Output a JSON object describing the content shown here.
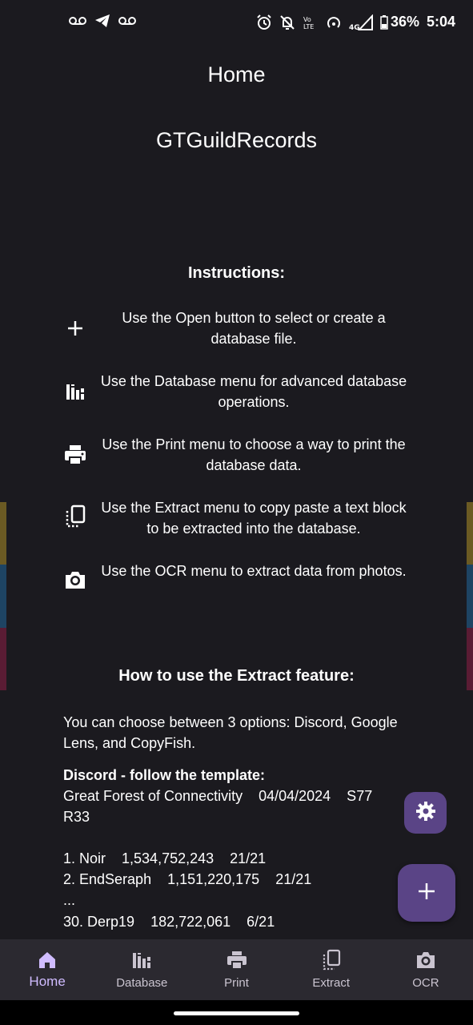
{
  "status_bar": {
    "battery": "36%",
    "time": "5:04",
    "network": "4G"
  },
  "appbar": {
    "title": "Home"
  },
  "app_name": "GTGuildRecords",
  "instructions": {
    "title": "Instructions:",
    "items": [
      {
        "icon": "add-icon",
        "text": "Use the Open button to select or create a database file."
      },
      {
        "icon": "database-icon",
        "text": "Use the Database menu for advanced database operations."
      },
      {
        "icon": "print-icon",
        "text": "Use the Print menu to choose a way to print the database data."
      },
      {
        "icon": "extract-icon",
        "text": "Use the Extract menu to copy paste a text block to be extracted into the database."
      },
      {
        "icon": "camera-icon",
        "text": "Use the OCR menu to extract data from photos."
      }
    ]
  },
  "extract_help": {
    "title": "How to use the Extract feature:",
    "intro": "You can choose between 3 options: Discord, Google Lens, and CopyFish.",
    "discord_heading": "Discord - follow the template:",
    "template_line1": "Great Forest of Connectivity    04/04/2024    S77",
    "template_line2": "R33",
    "template_rows": [
      "1. Noir    1,534,752,243    21/21",
      "2. EndSeraph    1,151,220,175    21/21",
      "...",
      "30. Derp19    182,722,061    6/21"
    ]
  },
  "bottom_nav": {
    "items": [
      {
        "label": "Home",
        "icon": "home-icon",
        "active": true
      },
      {
        "label": "Database",
        "icon": "database-icon",
        "active": false
      },
      {
        "label": "Print",
        "icon": "print-icon",
        "active": false
      },
      {
        "label": "Extract",
        "icon": "extract-icon",
        "active": false
      },
      {
        "label": "OCR",
        "icon": "camera-icon",
        "active": false
      }
    ]
  },
  "colors": {
    "background": "#1b1a1f",
    "nav_background": "#2b2930",
    "accent": "#d0bcff",
    "fab": "#5a4486",
    "side_bar_colors": [
      "#6b5a23",
      "#1e4463",
      "#5a1c34"
    ]
  }
}
